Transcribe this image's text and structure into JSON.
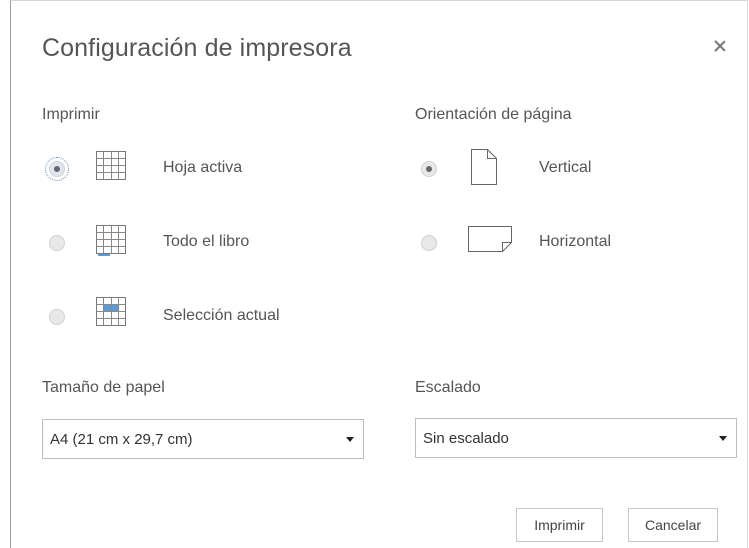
{
  "dialog": {
    "title": "Configuración de impresora",
    "close_icon": "close-icon"
  },
  "print_section": {
    "label": "Imprimir",
    "options": [
      {
        "label": "Hoja activa",
        "icon": "active-sheet-grid-icon",
        "selected": true
      },
      {
        "label": "Todo el libro",
        "icon": "whole-workbook-grid-icon",
        "selected": false
      },
      {
        "label": "Selección actual",
        "icon": "current-selection-grid-icon",
        "selected": false
      }
    ]
  },
  "orientation_section": {
    "label": "Orientación de página",
    "options": [
      {
        "label": "Vertical",
        "icon": "portrait-page-icon",
        "selected": true
      },
      {
        "label": "Horizontal",
        "icon": "landscape-page-icon",
        "selected": false
      }
    ]
  },
  "paper_size": {
    "label": "Tamaño de papel",
    "value": "A4 (21 cm x 29,7 cm)"
  },
  "scaling": {
    "label": "Escalado",
    "value": "Sin escalado"
  },
  "buttons": {
    "print": "Imprimir",
    "cancel": "Cancelar"
  },
  "colors": {
    "accent_blue": "#5b9bd5",
    "text": "#555555",
    "border": "#bdbdbd"
  }
}
